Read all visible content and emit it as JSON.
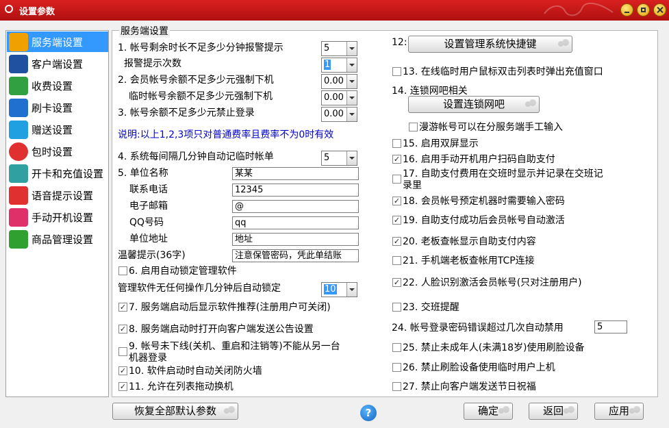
{
  "window": {
    "title": "设置参数",
    "accent": "#c41818"
  },
  "sidebar": {
    "items": [
      {
        "label": "服务端设置",
        "icon": "server-icon",
        "color": "#f0a000"
      },
      {
        "label": "客户端设置",
        "icon": "monitor-icon",
        "color": "#2050a0"
      },
      {
        "label": "收费设置",
        "icon": "billing-icon",
        "color": "#30a040"
      },
      {
        "label": "刷卡设置",
        "icon": "card-icon",
        "color": "#2070d0"
      },
      {
        "label": "赠送设置",
        "icon": "gift-icon",
        "color": "#20a0e0"
      },
      {
        "label": "包时设置",
        "icon": "clock-icon",
        "color": "#e03030"
      },
      {
        "label": "开卡和充值设置",
        "icon": "id-card-icon",
        "color": "#30a0a0"
      },
      {
        "label": "语音提示设置",
        "icon": "microphone-icon",
        "color": "#e03030"
      },
      {
        "label": "手动开机设置",
        "icon": "hand-pointer-icon",
        "color": "#e0306a"
      },
      {
        "label": "商品管理设置",
        "icon": "shopping-cart-icon",
        "color": "#30a030"
      }
    ]
  },
  "section": {
    "title": "服务端设置"
  },
  "left": {
    "r1": {
      "label": "1. 帐号剩余时长不足多少分钟报警提示",
      "value": "5"
    },
    "r1b": {
      "label": "报警提示次数",
      "value": "1"
    },
    "r2": {
      "label": "2. 会员帐号余额不足多少元强制下机",
      "value": "0.00"
    },
    "r2b": {
      "label": "临时帐号余额不足多少元强制下机",
      "value": "0.00"
    },
    "r3": {
      "label": "3. 帐号余额不足多少元禁止登录",
      "value": "0.00"
    },
    "note": "说明:以上1,2,3项只对普通费率且费率不为0时有效",
    "r4": {
      "label": "4. 系统每间隔几分钟自动记临时帐单",
      "value": "5"
    },
    "r5": {
      "name_label": "5. 单位名称",
      "name": "某某",
      "phone_label": "联系电话",
      "phone": "12345",
      "email_label": "电子邮箱",
      "email": "@",
      "qq_label": "QQ号码",
      "qq": "qq",
      "address_label": "单位地址",
      "address": "地址",
      "tip_label": "温馨提示(36字)",
      "tip": "注意保管密码，凭此单结账"
    },
    "c6": {
      "label": "6. 启用自动锁定管理软件",
      "checked": false
    },
    "lock": {
      "label": "管理软件无任何操作几分钟后自动锁定",
      "value": "10"
    },
    "c7": {
      "label": "7. 服务端启动后显示软件推荐(注册用户可关闭)",
      "checked": true
    },
    "c8": {
      "label": "8. 服务端启动时打开向客户端发送公告设置",
      "checked": true
    },
    "c9": {
      "line1": "9. 帐号未下线(关机、重启和注销等)不能从另一台",
      "line2": "机器登录",
      "checked": false
    },
    "c10": {
      "label": "10. 软件启动时自动关闭防火墙",
      "checked": true
    },
    "c11": {
      "label": "11. 允许在列表拖动换机",
      "checked": true
    }
  },
  "right": {
    "r12": {
      "label": "12:",
      "button": "设置管理系统快捷键"
    },
    "c13": {
      "label": "13. 在线临时用户鼠标双击列表时弹出充值窗口",
      "checked": false
    },
    "r14": {
      "label": "14. 连锁网吧相关",
      "button": "设置连锁网吧"
    },
    "c14b": {
      "label": "漫游帐号可以在分服务端手工输入",
      "checked": false
    },
    "c15": {
      "label": "15. 启用双屏显示",
      "checked": false
    },
    "c16": {
      "label": "16. 启用手动开机用户扫码自助支付",
      "checked": true
    },
    "c17": {
      "line1": "17. 自助支付费用在交班时显示并记录在交班记",
      "line2": "录里",
      "checked": false
    },
    "c18": {
      "label": "18. 会员帐号预定机器时需要输入密码",
      "checked": true
    },
    "c19": {
      "label": "19. 自助支付成功后会员帐号自动激活",
      "checked": true
    },
    "c20": {
      "label": "20. 老板查帐显示自助支付内容",
      "checked": true
    },
    "c21": {
      "label": "21. 手机端老板查帐用TCP连接",
      "checked": false
    },
    "c22": {
      "label": "22. 人脸识别激活会员帐号(只对注册用户)",
      "checked": true
    },
    "c23": {
      "label": "23. 交班提醒",
      "checked": false
    },
    "r24": {
      "label": "24. 帐号登录密码错误超过几次自动禁用",
      "value": "5"
    },
    "c25": {
      "label": "25. 禁止未成年人(未满18岁)使用刷脸设备",
      "checked": false
    },
    "c26": {
      "label": "26. 禁止刷脸设备使用临时用户上机",
      "checked": false
    },
    "c27": {
      "label": "27. 禁止向客户端发送节日祝福",
      "checked": false
    }
  },
  "footer": {
    "restore": "恢复全部默认参数",
    "help": "?",
    "ok": "确定",
    "back": "返回",
    "apply": "应用"
  }
}
